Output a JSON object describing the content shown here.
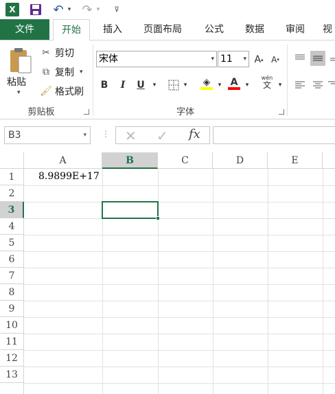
{
  "qat": {
    "app_icon": "X",
    "save_icon": "save-icon",
    "undo_icon": "undo-icon",
    "redo_icon": "redo-icon"
  },
  "tabs": [
    {
      "label": "文件"
    },
    {
      "label": "开始"
    },
    {
      "label": "插入"
    },
    {
      "label": "页面布局"
    },
    {
      "label": "公式"
    },
    {
      "label": "数据"
    },
    {
      "label": "审阅"
    },
    {
      "label": "视"
    }
  ],
  "clipboard": {
    "paste": "粘贴",
    "cut": "剪切",
    "copy": "复制",
    "format_painter": "格式刷",
    "group_label": "剪贴板"
  },
  "font": {
    "name": "宋体",
    "size": "11",
    "grow": "A",
    "shrink": "A",
    "bold": "B",
    "italic": "I",
    "underline": "U",
    "font_color": "A",
    "group_label": "字体",
    "wen": "wén",
    "wen_char": "文"
  },
  "formula_bar": {
    "name_box": "B3",
    "fx": "fx",
    "formula": ""
  },
  "grid": {
    "columns": [
      "A",
      "B",
      "C",
      "D",
      "E"
    ],
    "rows": [
      "1",
      "2",
      "3",
      "4",
      "5",
      "6",
      "7",
      "8",
      "9",
      "10",
      "11",
      "12",
      "13"
    ],
    "cell_A1": "8.9899E+17",
    "active_cell": "B3"
  },
  "colors": {
    "accent": "#217346",
    "fill_highlight": "#ffff00",
    "font_red": "#ff0000"
  }
}
